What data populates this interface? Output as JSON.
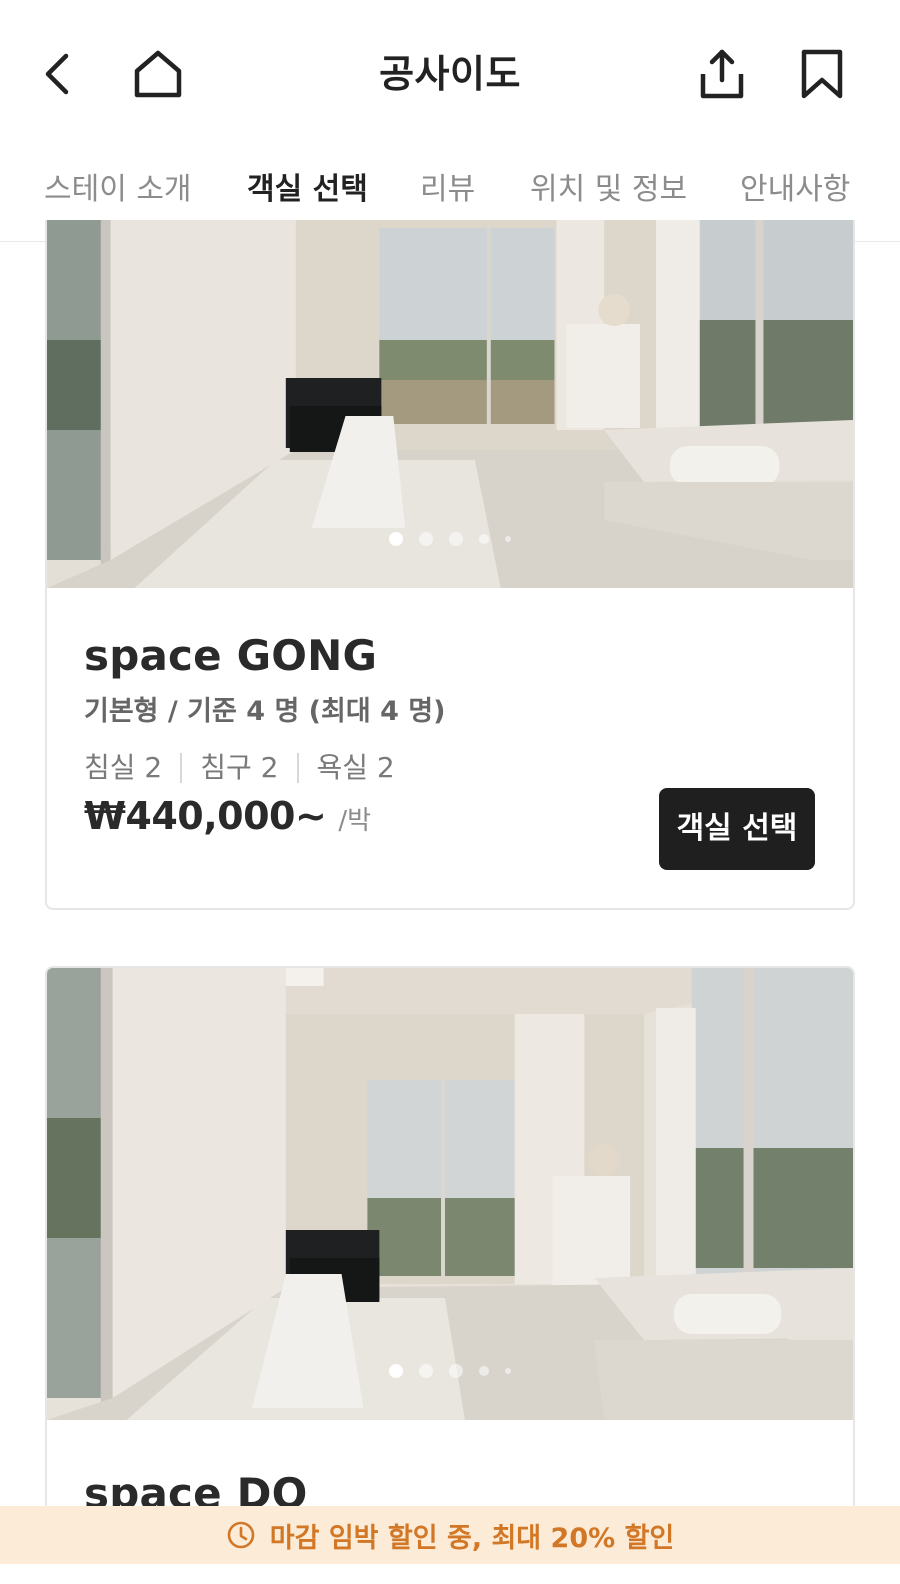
{
  "header": {
    "title": "공사이도",
    "back_icon": "chevron-left-icon",
    "home_icon": "home-icon",
    "share_icon": "share-icon",
    "bookmark_icon": "bookmark-icon"
  },
  "tabs": [
    {
      "label": "스테이 소개",
      "active": false
    },
    {
      "label": "객실 선택",
      "active": true
    },
    {
      "label": "리뷰",
      "active": false
    },
    {
      "label": "위치 및 정보",
      "active": false
    },
    {
      "label": "안내사항",
      "active": false
    }
  ],
  "rooms": [
    {
      "name": "space GONG",
      "type": "기본형 / 기준 4 명 (최대 4 명)",
      "specs": [
        "침실 2",
        "침구 2",
        "욕실 2"
      ],
      "price": "₩440,000~",
      "per": "/박",
      "button": "객실 선택",
      "photo_count": 5,
      "photo_index": 1
    },
    {
      "name": "space DO",
      "photo_count": 5,
      "photo_index": 1
    }
  ],
  "banner": {
    "icon": "clock-icon",
    "text": "마감 임박 할인 중, 최대 20% 할인"
  },
  "colors": {
    "accent_text": "#d27726",
    "banner_bg": "#fbebd7",
    "button_bg": "#1f1f1f"
  }
}
